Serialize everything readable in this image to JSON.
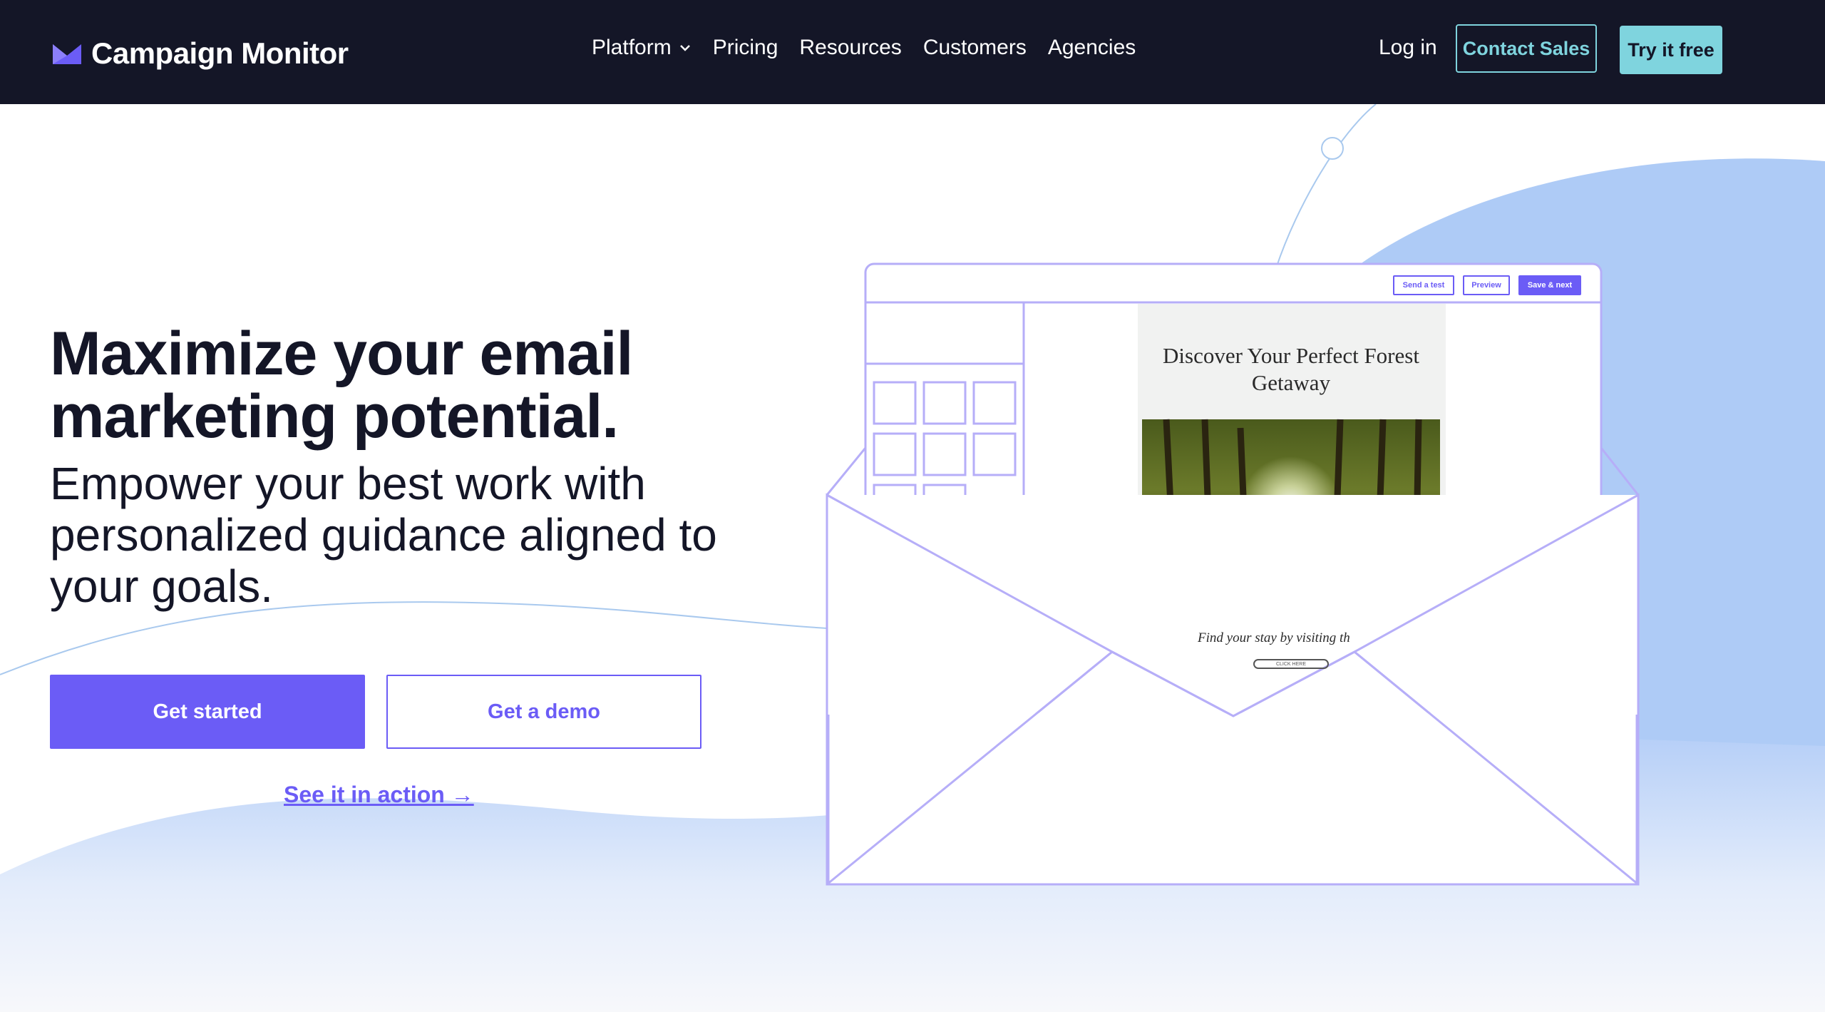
{
  "brand": {
    "name": "Campaign Monitor",
    "accent": "#6b5cf6",
    "nav_bg": "#141627",
    "teal": "#7fd4de"
  },
  "nav": {
    "links": [
      {
        "label": "Platform"
      },
      {
        "label": "Pricing"
      },
      {
        "label": "Resources"
      },
      {
        "label": "Customers"
      },
      {
        "label": "Agencies"
      }
    ],
    "login": "Log in",
    "contact_sales": "Contact Sales",
    "try_free": "Try it free"
  },
  "hero": {
    "headline": "Maximize your email marketing potential.",
    "subheadline": "Empower your best work with personalized guidance aligned to your goals.",
    "primary_cta": "Get started",
    "secondary_cta": "Get a demo",
    "tertiary_link": "See it in action →"
  },
  "illustration": {
    "editor_buttons": [
      "Send a test",
      "Preview",
      "Save & next"
    ],
    "email_title": "Discover Your Perfect Forest Getaway",
    "email_tagline": "Find your stay by visiting th",
    "email_cta": "CLICK HERE"
  }
}
